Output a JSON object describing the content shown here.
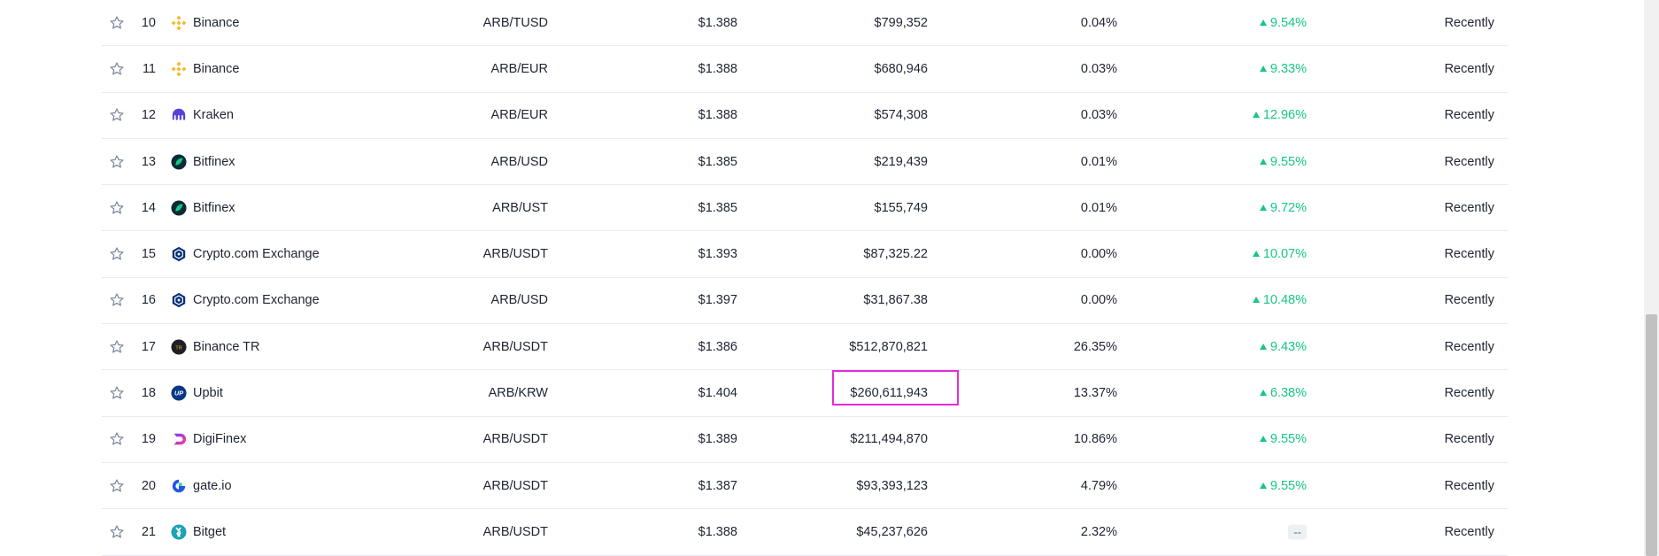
{
  "markets": [
    {
      "rank": "10",
      "exchange": "Binance",
      "logo": "binance",
      "pair": "ARB/TUSD",
      "price": "$1.388",
      "volume": "$799,352",
      "volume_pct": "0.04%",
      "change": "9.54%",
      "updated": "Recently"
    },
    {
      "rank": "11",
      "exchange": "Binance",
      "logo": "binance",
      "pair": "ARB/EUR",
      "price": "$1.388",
      "volume": "$680,946",
      "volume_pct": "0.03%",
      "change": "9.33%",
      "updated": "Recently"
    },
    {
      "rank": "12",
      "exchange": "Kraken",
      "logo": "kraken",
      "pair": "ARB/EUR",
      "price": "$1.388",
      "volume": "$574,308",
      "volume_pct": "0.03%",
      "change": "12.96%",
      "updated": "Recently"
    },
    {
      "rank": "13",
      "exchange": "Bitfinex",
      "logo": "bitfinex",
      "pair": "ARB/USD",
      "price": "$1.385",
      "volume": "$219,439",
      "volume_pct": "0.01%",
      "change": "9.55%",
      "updated": "Recently"
    },
    {
      "rank": "14",
      "exchange": "Bitfinex",
      "logo": "bitfinex",
      "pair": "ARB/UST",
      "price": "$1.385",
      "volume": "$155,749",
      "volume_pct": "0.01%",
      "change": "9.72%",
      "updated": "Recently"
    },
    {
      "rank": "15",
      "exchange": "Crypto.com Exchange",
      "logo": "cryptocom",
      "pair": "ARB/USDT",
      "price": "$1.393",
      "volume": "$87,325.22",
      "volume_pct": "0.00%",
      "change": "10.07%",
      "updated": "Recently"
    },
    {
      "rank": "16",
      "exchange": "Crypto.com Exchange",
      "logo": "cryptocom",
      "pair": "ARB/USD",
      "price": "$1.397",
      "volume": "$31,867.38",
      "volume_pct": "0.00%",
      "change": "10.48%",
      "updated": "Recently"
    },
    {
      "rank": "17",
      "exchange": "Binance TR",
      "logo": "binancetr",
      "pair": "ARB/USDT",
      "price": "$1.386",
      "volume": "$512,870,821",
      "volume_pct": "26.35%",
      "change": "9.43%",
      "updated": "Recently"
    },
    {
      "rank": "18",
      "exchange": "Upbit",
      "logo": "upbit",
      "pair": "ARB/KRW",
      "price": "$1.404",
      "volume": "$260,611,943",
      "volume_pct": "13.37%",
      "change": "6.38%",
      "updated": "Recently"
    },
    {
      "rank": "19",
      "exchange": "DigiFinex",
      "logo": "digifinex",
      "pair": "ARB/USDT",
      "price": "$1.389",
      "volume": "$211,494,870",
      "volume_pct": "10.86%",
      "change": "9.55%",
      "updated": "Recently"
    },
    {
      "rank": "20",
      "exchange": "gate.io",
      "logo": "gateio",
      "pair": "ARB/USDT",
      "price": "$1.387",
      "volume": "$93,393,123",
      "volume_pct": "4.79%",
      "change": "9.55%",
      "updated": "Recently"
    },
    {
      "rank": "21",
      "exchange": "Bitget",
      "logo": "bitget",
      "pair": "ARB/USDT",
      "price": "$1.388",
      "volume": "$45,237,626",
      "volume_pct": "2.32%",
      "change": "--",
      "updated": "Recently"
    }
  ],
  "colors": {
    "positive": "#16c784",
    "highlight": "#e52ad9",
    "star": "#7a8499"
  }
}
